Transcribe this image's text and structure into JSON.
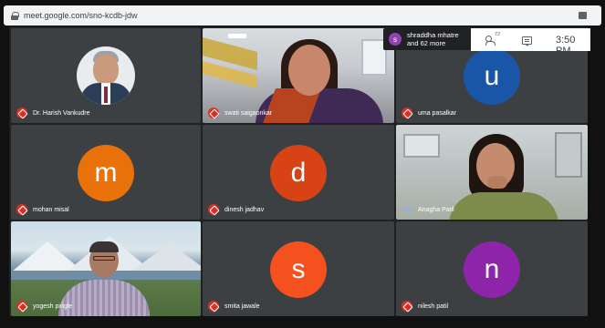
{
  "browser": {
    "url": "meet.google.com/sno-kcdb-jdw"
  },
  "toast": {
    "initial": "s",
    "line1": "shraddha mhatre",
    "line2": "and 62 more"
  },
  "topbar": {
    "participant_count": "72",
    "time": "3:50 PM"
  },
  "colors": {
    "tile_bg": "#3c4043",
    "muted_red": "#d93025",
    "orange": "#e8710a",
    "deep_orange": "#e8481d",
    "blue": "#1a56a8",
    "purple": "#8e24aa"
  },
  "participants": [
    {
      "name": "Dr. Harish Vankudre",
      "muted": true,
      "type": "photo"
    },
    {
      "name": "swati saigaonkar",
      "muted": true,
      "type": "photo"
    },
    {
      "name": "uma pasalkar",
      "muted": true,
      "initial": "u",
      "color": "#1a56a8"
    },
    {
      "name": "mohan misal",
      "muted": true,
      "initial": "m",
      "color": "#e8710a"
    },
    {
      "name": "dinesh jadhav",
      "muted": true,
      "initial": "d",
      "color": "#d84315"
    },
    {
      "name": "Anagha Patil",
      "muted": false,
      "type": "photo"
    },
    {
      "name": "yogesh pingle",
      "muted": true,
      "type": "photo"
    },
    {
      "name": "smita jawale",
      "muted": true,
      "initial": "s",
      "color": "#f4511e"
    },
    {
      "name": "nilesh patil",
      "muted": true,
      "initial": "n",
      "color": "#8e24aa"
    }
  ]
}
